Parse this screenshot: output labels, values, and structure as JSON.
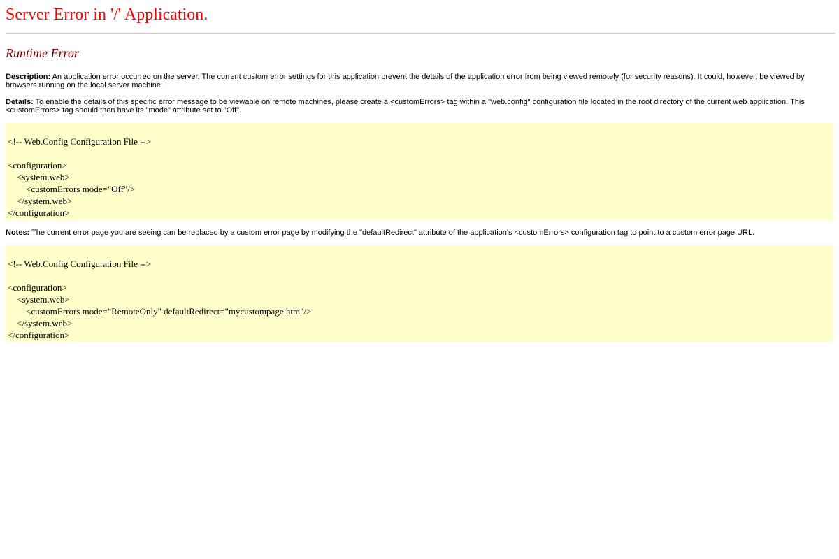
{
  "page": {
    "title": "Server Error in '/' Application.",
    "subtitle": "Runtime Error"
  },
  "description": {
    "label": "Description:",
    "text": " An application error occurred on the server. The current custom error settings for this application prevent the details of the application error from being viewed remotely (for security reasons). It could, however, be viewed by browsers running on the local server machine."
  },
  "details": {
    "label": "Details:",
    "text": " To enable the details of this specific error message to be viewable on remote machines, please create a <customErrors> tag within a \"web.config\" configuration file located in the root directory of the current web application. This <customErrors> tag should then have its \"mode\" attribute set to \"Off\"."
  },
  "code1": {
    "lines": [
      "<!-- Web.Config Configuration File -->",
      "",
      "<configuration>",
      "    <system.web>",
      "        <customErrors mode=\"Off\"/>",
      "    </system.web>",
      "</configuration>"
    ]
  },
  "notes": {
    "label": "Notes:",
    "text": " The current error page you are seeing can be replaced by a custom error page by modifying the \"defaultRedirect\" attribute of the application's <customErrors> configuration tag to point to a custom error page URL."
  },
  "code2": {
    "lines": [
      "<!-- Web.Config Configuration File -->",
      "",
      "<configuration>",
      "    <system.web>",
      "        <customErrors mode=\"RemoteOnly\" defaultRedirect=\"mycustompage.htm\"/>",
      "    </system.web>",
      "</configuration>"
    ]
  },
  "colors": {
    "title": "#ff0000",
    "subtitle": "#800000",
    "code_background": "#ffffcc"
  }
}
